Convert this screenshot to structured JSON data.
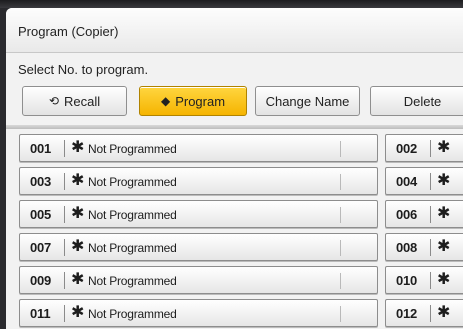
{
  "window": {
    "title": "Program (Copier)",
    "instruction": "Select No. to program."
  },
  "toolbar": {
    "recall": {
      "label": "Recall",
      "icon": "recall-arrow-icon"
    },
    "program": {
      "label": "Program",
      "icon": "program-arrow-icon",
      "selected": true
    },
    "change_name": {
      "label": "Change Name"
    },
    "delete": {
      "label": "Delete"
    }
  },
  "star_glyph": "✱",
  "programs": [
    {
      "number": "001",
      "name": "Not Programmed"
    },
    {
      "number": "002",
      "name": ""
    },
    {
      "number": "003",
      "name": "Not Programmed"
    },
    {
      "number": "004",
      "name": ""
    },
    {
      "number": "005",
      "name": "Not Programmed"
    },
    {
      "number": "006",
      "name": ""
    },
    {
      "number": "007",
      "name": "Not Programmed"
    },
    {
      "number": "008",
      "name": ""
    },
    {
      "number": "009",
      "name": "Not Programmed"
    },
    {
      "number": "010",
      "name": ""
    },
    {
      "number": "011",
      "name": "Not Programmed"
    },
    {
      "number": "012",
      "name": ""
    }
  ],
  "colors": {
    "selected_button": "#f7bd12",
    "panel_background": "#f2f2f2"
  }
}
